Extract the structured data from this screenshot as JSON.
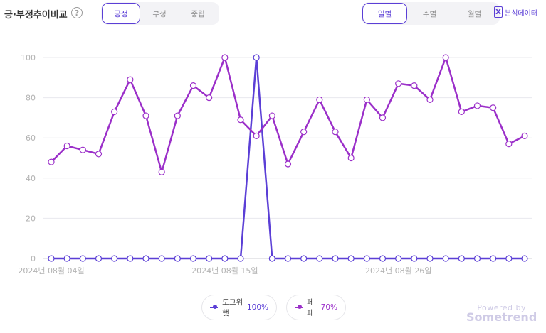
{
  "header": {
    "title": "긍·부정추이비교",
    "help_glyph": "?",
    "sentiment_tabs": [
      "긍정",
      "부정",
      "중립"
    ],
    "sentiment_active": 0,
    "period_tabs": [
      "일별",
      "주별",
      "월별"
    ],
    "period_active": 0,
    "excel_glyph": "X",
    "export_label": "분석데이터"
  },
  "legend": [
    {
      "name": "도그위햇",
      "value": "100%",
      "color": "#5b3fd6"
    },
    {
      "name": "페페",
      "value": "70%",
      "color": "#9b2fc9"
    }
  ],
  "brand": {
    "powered": "Powered by",
    "name": "Sometrend"
  },
  "chart_data": {
    "type": "line",
    "ylim": [
      0,
      100
    ],
    "yticks": [
      0,
      20,
      40,
      60,
      80,
      100
    ],
    "x": [
      "2024-08-04",
      "2024-08-05",
      "2024-08-06",
      "2024-08-07",
      "2024-08-08",
      "2024-08-09",
      "2024-08-10",
      "2024-08-11",
      "2024-08-12",
      "2024-08-13",
      "2024-08-14",
      "2024-08-15",
      "2024-08-16",
      "2024-08-17",
      "2024-08-18",
      "2024-08-19",
      "2024-08-20",
      "2024-08-21",
      "2024-08-22",
      "2024-08-23",
      "2024-08-24",
      "2024-08-25",
      "2024-08-26",
      "2024-08-27",
      "2024-08-28",
      "2024-08-29",
      "2024-08-30",
      "2024-08-31",
      "2024-09-01",
      "2024-09-02",
      "2024-09-03"
    ],
    "x_tick_labels": [
      {
        "index": 0,
        "label": "2024년 08월 04일"
      },
      {
        "index": 11,
        "label": "2024년 08월 15일"
      },
      {
        "index": 22,
        "label": "2024년 08월 26일"
      }
    ],
    "grid": true,
    "series": [
      {
        "name": "도그위햇",
        "color": "#5b3fd6",
        "values": [
          0,
          0,
          0,
          0,
          0,
          0,
          0,
          0,
          0,
          0,
          0,
          0,
          0,
          100,
          0,
          0,
          0,
          0,
          0,
          0,
          0,
          0,
          0,
          0,
          0,
          0,
          0,
          0,
          0,
          0,
          0
        ]
      },
      {
        "name": "페페",
        "color": "#9b2fc9",
        "values": [
          48,
          56,
          54,
          52,
          73,
          89,
          71,
          43,
          71,
          86,
          80,
          100,
          69,
          61,
          71,
          47,
          63,
          79,
          63,
          50,
          79,
          70,
          87,
          86,
          79,
          100,
          73,
          76,
          75,
          57,
          61
        ]
      }
    ]
  }
}
